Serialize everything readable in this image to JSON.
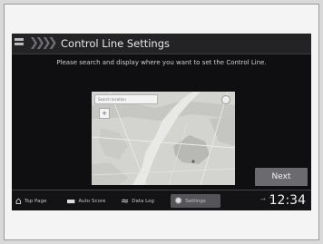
{
  "header": {
    "title": "Control Line Settings"
  },
  "instruction": "Please search and display where you want to set the Control Line.",
  "map": {
    "search_placeholder": "Search location",
    "zoom_label": "+"
  },
  "next_button": "Next",
  "nav": [
    {
      "label": "Top Page",
      "icon": "home-icon"
    },
    {
      "label": "Auto Score",
      "icon": "car-icon"
    },
    {
      "label": "Data Log",
      "icon": "data-log-icon"
    },
    {
      "label": "Settings",
      "icon": "gear-icon",
      "selected": true
    }
  ],
  "status": {
    "time": "12:34"
  }
}
